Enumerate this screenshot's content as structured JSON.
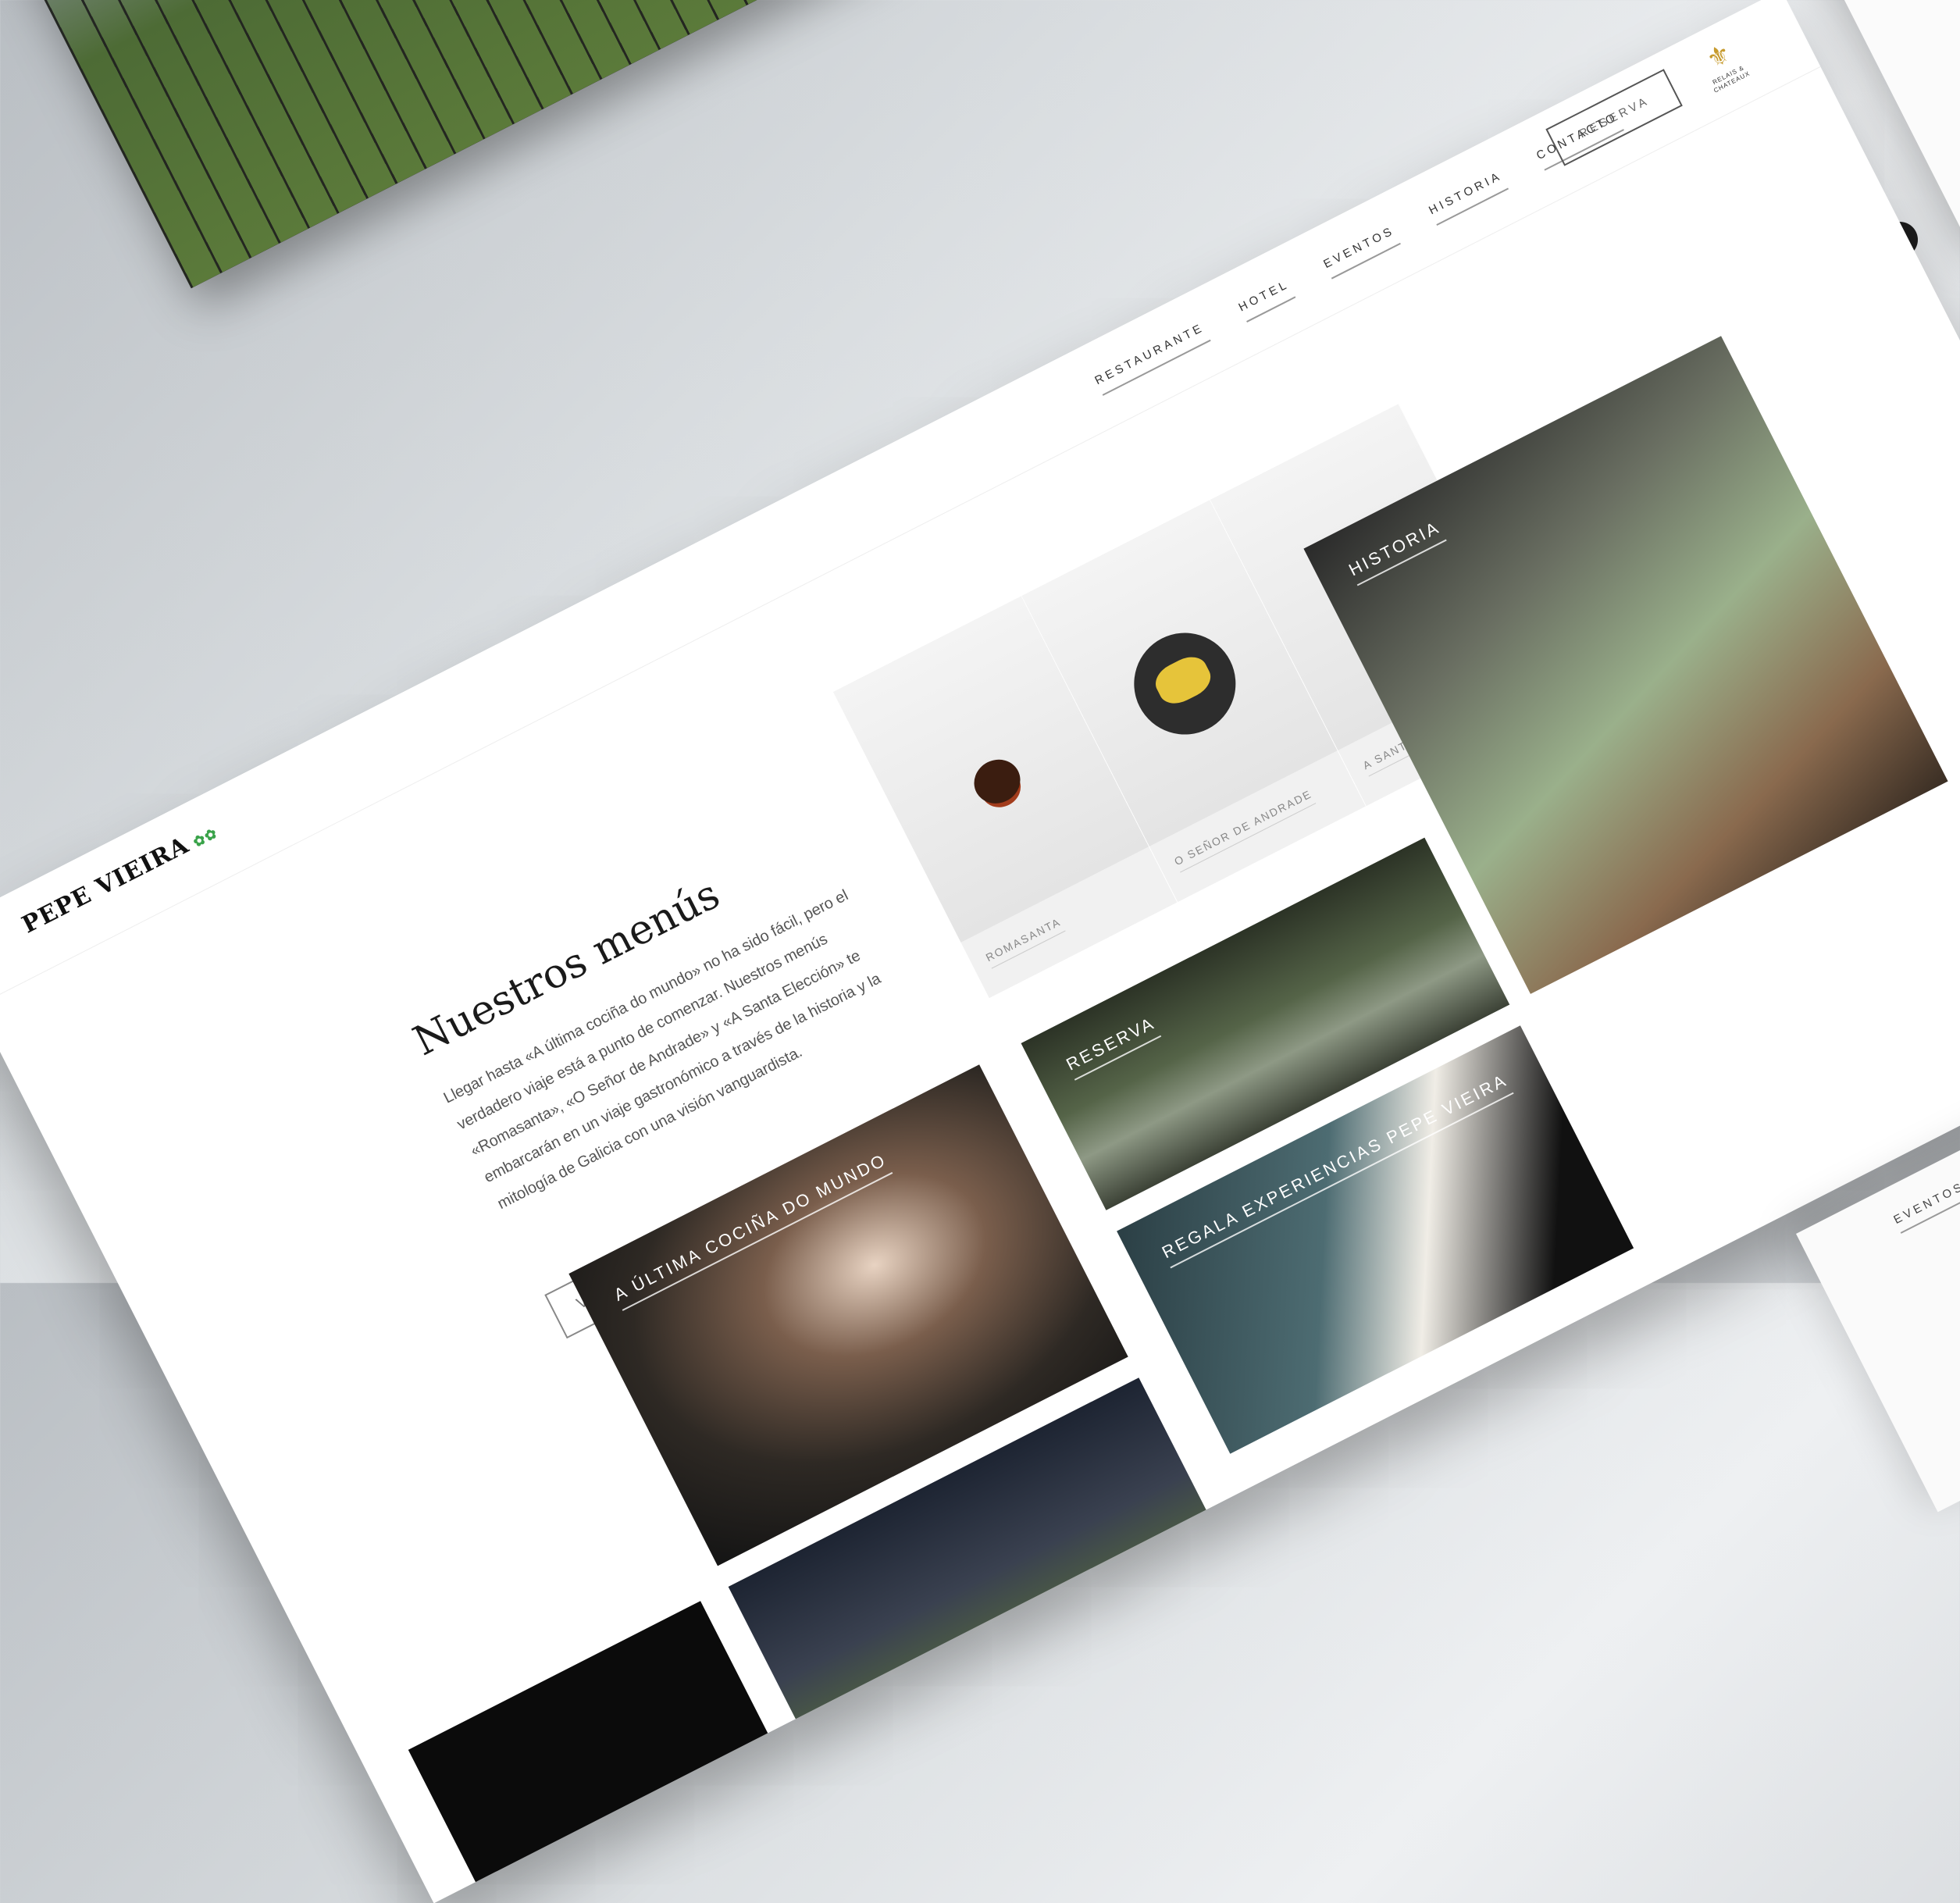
{
  "brand": {
    "name": "PEPE VIEIRA",
    "stars": "✿✿"
  },
  "nav": {
    "items": [
      "RESTAURANTE",
      "HOTEL",
      "EVENTOS",
      "HISTORIA",
      "CONTACTO"
    ],
    "reserve_label": "RESERVA"
  },
  "crest": {
    "symbol": "⚜",
    "text": "RELAIS & CHATEAUX"
  },
  "menus": {
    "title": "Nuestros menús",
    "body": "Llegar hasta «A última cociña do mundo» no ha sido fácil, pero el verdadero viaje está a punto de comenzar. Nuestros menús «Romasanta», «O Señor de Andrade» y «A Santa Elección» te embarcarán en un viaje gastronómico a través de la historia y la mitología de Galicia con una visión vanguardista.",
    "button": "VER LOS MENÚS"
  },
  "dishes": [
    {
      "label": "ROMASANTA"
    },
    {
      "label": "O SEÑOR DE ANDRADE"
    },
    {
      "label": "A SANTA ELECCIÓN"
    }
  ],
  "tiles": {
    "kitchen": "A ÚLTIMA COCIÑA DO MUNDO",
    "terrace": "RESERVA",
    "gift": "REGALA EXPERIENCIAS PEPE VIEIRA",
    "history": "HISTORIA"
  },
  "icons": {
    "clock": "clock-icon"
  },
  "colors": {
    "michelin_green": "#3aa34a",
    "crest_gold": "#c79b2e"
  }
}
